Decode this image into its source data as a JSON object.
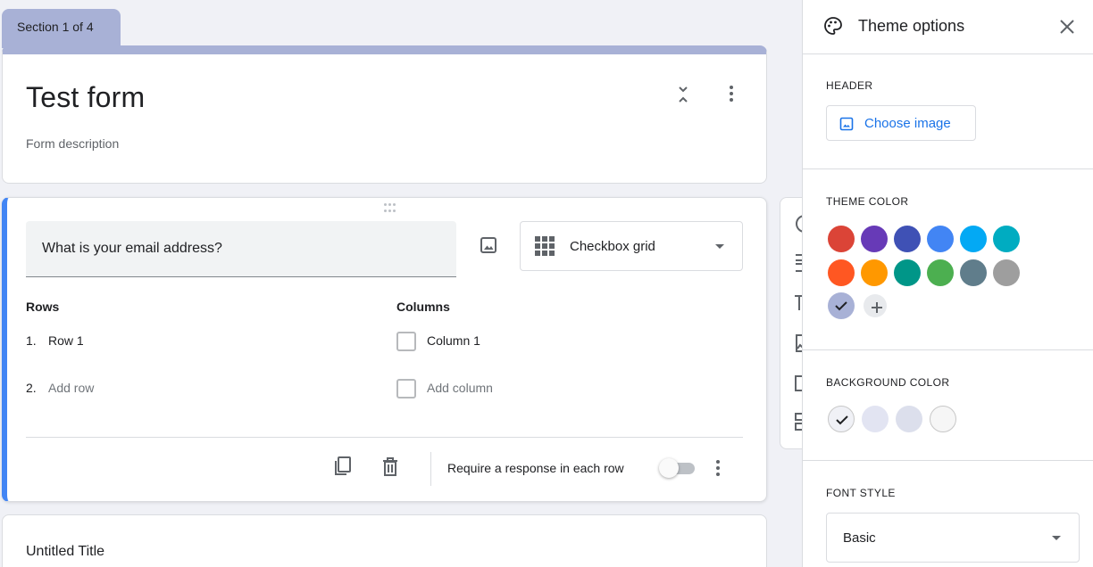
{
  "section_tab": "Section 1 of 4",
  "form": {
    "title": "Test form",
    "description": "Form description"
  },
  "question": {
    "text": "What is your email address?",
    "type": "Checkbox grid",
    "rows_heading": "Rows",
    "columns_heading": "Columns",
    "rows": [
      {
        "num": "1.",
        "label": "Row 1"
      },
      {
        "num": "2.",
        "label": "Add row"
      }
    ],
    "columns": [
      "Column 1",
      "Add column"
    ],
    "require_label": "Require a response in each row",
    "require_on": false
  },
  "next_card": {
    "title": "Untitled Title"
  },
  "theme_panel": {
    "title": "Theme options",
    "header_label": "HEADER",
    "choose_image_label": "Choose image",
    "theme_color_label": "THEME COLOR",
    "theme_colors": [
      "#db4437",
      "#673ab7",
      "#3f51b5",
      "#4285f4",
      "#03a9f4",
      "#00acc1",
      "#ff5722",
      "#ff9800",
      "#009688",
      "#4caf50",
      "#607d8b",
      "#9e9e9e"
    ],
    "selected_theme_color": "#a8b1d6",
    "background_color_label": "BACKGROUND COLOR",
    "background_colors": [
      "#f0f1f6",
      "#e2e4f2",
      "#dcdfec",
      "#f6f6f6"
    ],
    "selected_background_index": 0,
    "font_style_label": "FONT STYLE",
    "font_style_value": "Basic"
  }
}
